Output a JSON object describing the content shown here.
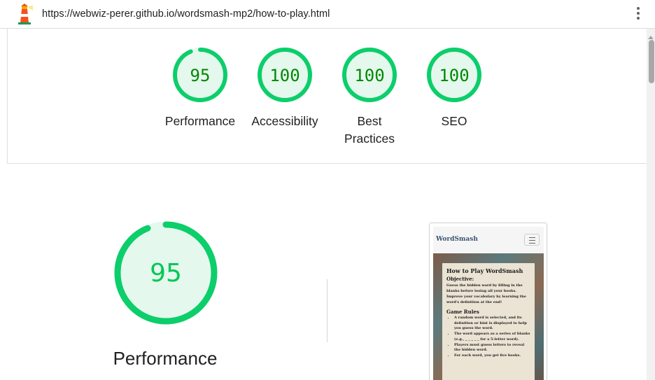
{
  "browser": {
    "url": "https://webwiz-perer.github.io/wordsmash-mp2/how-to-play.html",
    "icons": {
      "logo": "lighthouse-icon",
      "menu": "kebab-menu-icon"
    }
  },
  "summary_gauges": [
    {
      "score": "95",
      "value": 95,
      "label": "Performance"
    },
    {
      "score": "100",
      "value": 100,
      "label": "Accessibility"
    },
    {
      "score": "100",
      "value": 100,
      "label": "Best Practices"
    },
    {
      "score": "100",
      "value": 100,
      "label": "SEO"
    }
  ],
  "performance": {
    "score": "95",
    "value": 95,
    "label": "Performance"
  },
  "colors": {
    "pass": "#0cce6b",
    "pass_fill": "#e5f8ee",
    "pass_text": "#008800"
  },
  "screenshot": {
    "brand": "WordSmash",
    "title": "How to Play WordSmash",
    "objective_heading": "Objective:",
    "objective_text": "Guess the hidden word by filling in the blanks before losing all your books. Improve your vocabulary by learning the word's definition at the end!",
    "rules_heading": "Game Rules",
    "rules": [
      "A random word is selected, and its definition or hint is displayed to help you guess the word.",
      "The word appears as a series of blanks (e.g., _ _ _ _ _ for a 5-letter word).",
      "Players must guess letters to reveal the hidden word.",
      "For each word, you get five books."
    ]
  }
}
